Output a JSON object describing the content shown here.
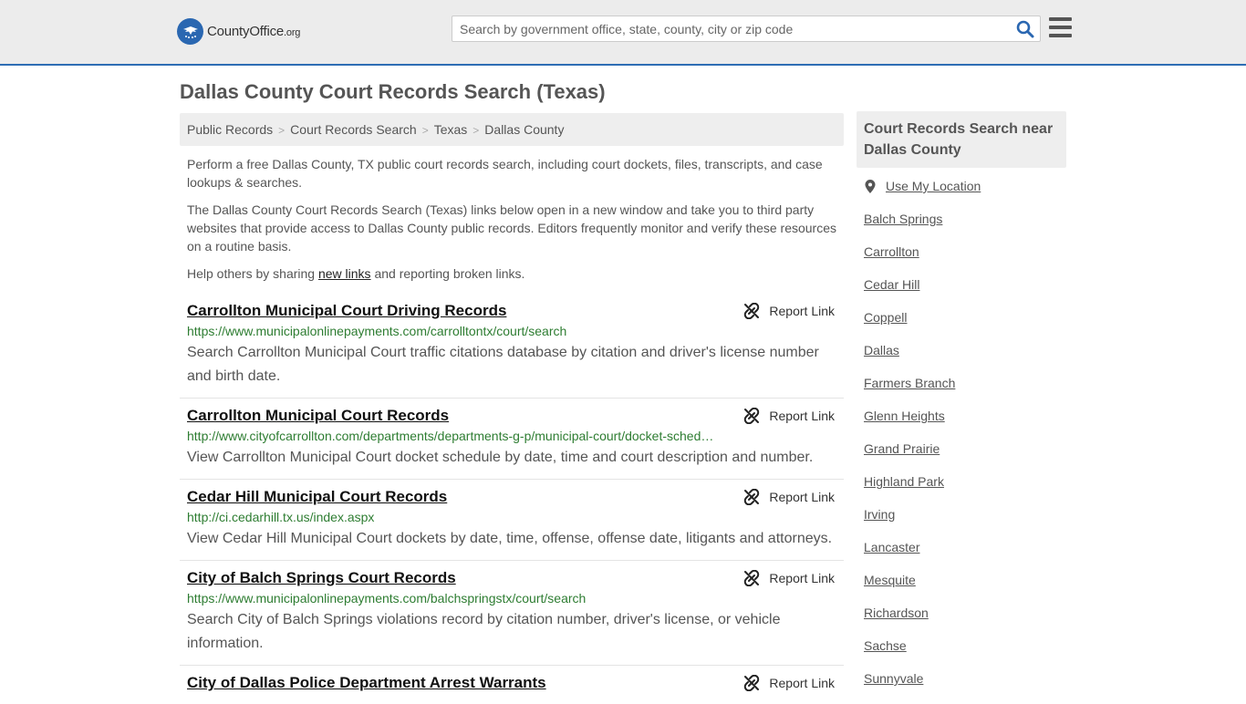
{
  "header": {
    "logo_main": "CountyOffice",
    "logo_tld": ".org",
    "search_placeholder": "Search by government office, state, county, city or zip code"
  },
  "page_title": "Dallas County Court Records Search (Texas)",
  "breadcrumb": [
    "Public Records",
    "Court Records Search",
    "Texas",
    "Dallas County"
  ],
  "intro": {
    "p1": "Perform a free Dallas County, TX public court records search, including court dockets, files, transcripts, and case lookups & searches.",
    "p2": "The Dallas County Court Records Search (Texas) links below open in a new window and take you to third party websites that provide access to Dallas County public records. Editors frequently monitor and verify these resources on a routine basis.",
    "p3_before": "Help others by sharing ",
    "p3_link": "new links",
    "p3_after": " and reporting broken links."
  },
  "report_label": "Report Link",
  "results": [
    {
      "title": "Carrollton Municipal Court Driving Records",
      "url": "https://www.municipalonlinepayments.com/carrolltontx/court/search",
      "desc": "Search Carrollton Municipal Court traffic citations database by citation and driver's license number and birth date."
    },
    {
      "title": "Carrollton Municipal Court Records",
      "url": "http://www.cityofcarrollton.com/departments/departments-g-p/municipal-court/docket-sched…",
      "desc": "View Carrollton Municipal Court docket schedule by date, time and court description and number."
    },
    {
      "title": "Cedar Hill Municipal Court Records",
      "url": "http://ci.cedarhill.tx.us/index.aspx",
      "desc": "View Cedar Hill Municipal Court dockets by date, time, offense, offense date, litigants and attorneys."
    },
    {
      "title": "City of Balch Springs Court Records",
      "url": "https://www.municipalonlinepayments.com/balchspringstx/court/search",
      "desc": "Search City of Balch Springs violations record by citation number, driver's license, or vehicle information."
    },
    {
      "title": "City of Dallas Police Department Arrest Warrants",
      "url": "",
      "desc": ""
    }
  ],
  "sidebar": {
    "heading": "Court Records Search near Dallas County",
    "use_location": "Use My Location",
    "places": [
      "Balch Springs",
      "Carrollton",
      "Cedar Hill",
      "Coppell",
      "Dallas",
      "Farmers Branch",
      "Glenn Heights",
      "Grand Prairie",
      "Highland Park",
      "Irving",
      "Lancaster",
      "Mesquite",
      "Richardson",
      "Sachse",
      "Sunnyvale"
    ]
  },
  "colors": {
    "accent": "#2e6db4",
    "url_green": "#2e7d32",
    "header_bg": "#ececec"
  }
}
